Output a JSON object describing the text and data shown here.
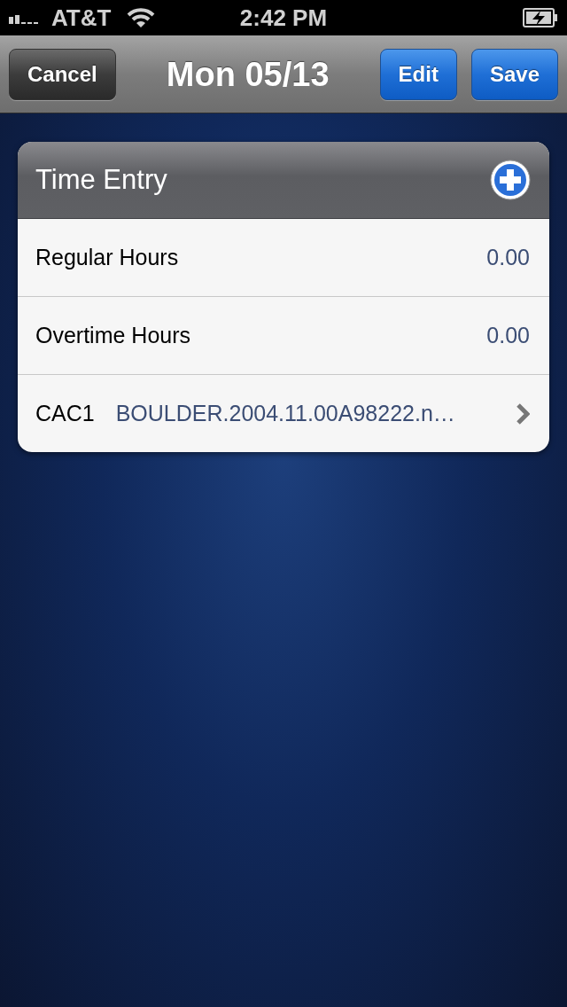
{
  "status_bar": {
    "carrier": "AT&T",
    "time": "2:42 PM",
    "charging": true
  },
  "nav_bar": {
    "left_buttons": [
      {
        "label": "Cancel",
        "kind": "plain"
      }
    ],
    "title": "Mon 05/13",
    "right_buttons": [
      {
        "label": "Edit",
        "kind": "primary"
      },
      {
        "label": "Save",
        "kind": "primary"
      }
    ]
  },
  "section": {
    "title": "Time Entry",
    "rows": [
      {
        "kind": "value",
        "label": "Regular Hours",
        "value": "0.00"
      },
      {
        "kind": "value",
        "label": "Overtime Hours",
        "value": "0.00"
      },
      {
        "kind": "disclosure",
        "label": "CAC1",
        "value": "BOULDER.2004.11.00A98222.n…"
      }
    ]
  }
}
